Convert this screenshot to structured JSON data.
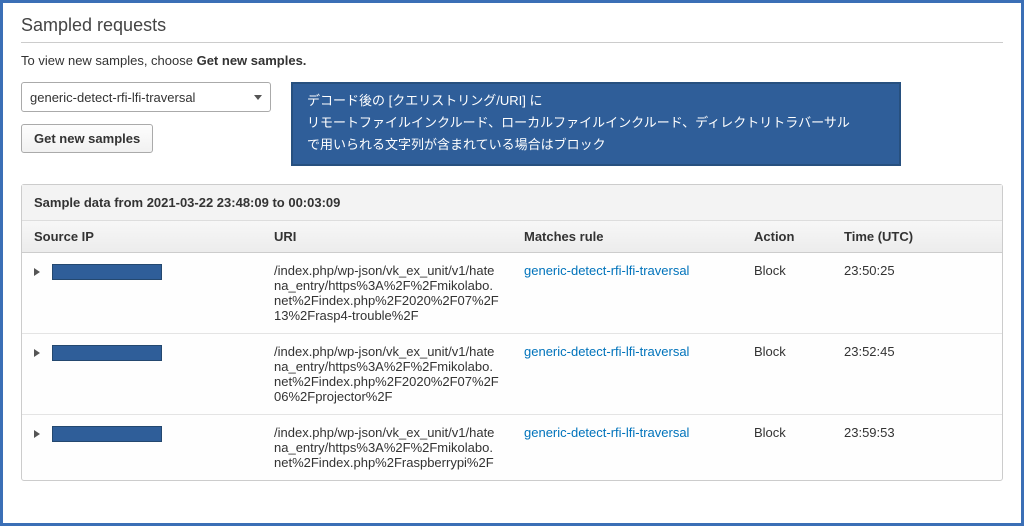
{
  "section_title": "Sampled requests",
  "hint_prefix": "To view new samples, choose ",
  "hint_bold": "Get new samples.",
  "filter": {
    "selected": "generic-detect-rfi-lfi-traversal"
  },
  "get_samples_button": "Get new samples",
  "callout": {
    "line1_pre": "デコード後の [クエリストリング",
    "line1_tag": "/URI",
    "line1_post": "] に",
    "line2": "リモートファイルインクルード、ローカルファイルインクルード、ディレクトリトラバーサル",
    "line3": "で用いられる文字列が含まれている場合はブロック"
  },
  "panel_header": "Sample data from 2021-03-22 23:48:09 to 00:03:09",
  "columns": {
    "source_ip": "Source IP",
    "uri": "URI",
    "matches_rule": "Matches rule",
    "action": "Action",
    "time": "Time (UTC)"
  },
  "rows": [
    {
      "uri": "/index.php/wp-json/vk_ex_unit/v1/hatena_entry/https%3A%2F%2Fmikolabo.net%2Findex.php%2F2020%2F07%2F13%2Frasp4-trouble%2F",
      "rule": "generic-detect-rfi-lfi-traversal",
      "action": "Block",
      "time": "23:50:25"
    },
    {
      "uri": "/index.php/wp-json/vk_ex_unit/v1/hatena_entry/https%3A%2F%2Fmikolabo.net%2Findex.php%2F2020%2F07%2F06%2Fprojector%2F",
      "rule": "generic-detect-rfi-lfi-traversal",
      "action": "Block",
      "time": "23:52:45"
    },
    {
      "uri": "/index.php/wp-json/vk_ex_unit/v1/hatena_entry/https%3A%2F%2Fmikolabo.net%2Findex.php%2Fraspberrypi%2F",
      "rule": "generic-detect-rfi-lfi-traversal",
      "action": "Block",
      "time": "23:59:53"
    }
  ]
}
